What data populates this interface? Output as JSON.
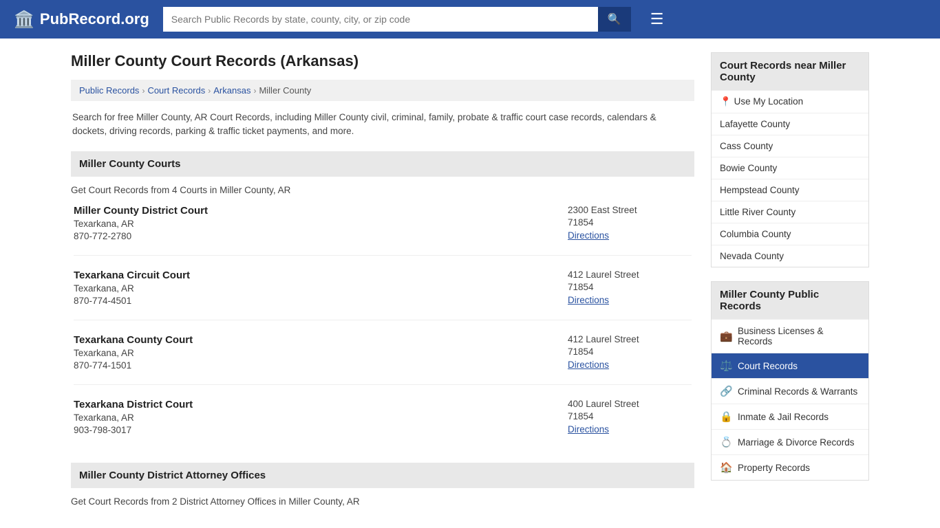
{
  "header": {
    "logo_text": "PubRecord.org",
    "search_placeholder": "Search Public Records by state, county, city, or zip code",
    "search_icon": "🔍",
    "menu_icon": "☰"
  },
  "page": {
    "title": "Miller County Court Records (Arkansas)",
    "breadcrumbs": [
      {
        "label": "Public Records",
        "href": "#"
      },
      {
        "label": "Court Records",
        "href": "#"
      },
      {
        "label": "Arkansas",
        "href": "#"
      },
      {
        "label": "Miller County",
        "href": "#"
      }
    ],
    "description": "Search for free Miller County, AR Court Records, including Miller County civil, criminal, family, probate & traffic court case records, calendars & dockets, driving records, parking & traffic ticket payments, and more."
  },
  "courts_section": {
    "header": "Miller County Courts",
    "intro": "Get Court Records from 4 Courts in Miller County, AR",
    "courts": [
      {
        "name": "Miller County District Court",
        "city": "Texarkana, AR",
        "phone": "870-772-2780",
        "street": "2300 East Street",
        "zip": "71854",
        "directions_label": "Directions"
      },
      {
        "name": "Texarkana Circuit Court",
        "city": "Texarkana, AR",
        "phone": "870-774-4501",
        "street": "412 Laurel Street",
        "zip": "71854",
        "directions_label": "Directions"
      },
      {
        "name": "Texarkana County Court",
        "city": "Texarkana, AR",
        "phone": "870-774-1501",
        "street": "412 Laurel Street",
        "zip": "71854",
        "directions_label": "Directions"
      },
      {
        "name": "Texarkana District Court",
        "city": "Texarkana, AR",
        "phone": "903-798-3017",
        "street": "400 Laurel Street",
        "zip": "71854",
        "directions_label": "Directions"
      }
    ]
  },
  "da_section": {
    "header": "Miller County District Attorney Offices",
    "intro": "Get Court Records from 2 District Attorney Offices in Miller County, AR"
  },
  "sidebar": {
    "nearby_header": "Court Records near Miller County",
    "nearby_items": [
      {
        "label": "Use My Location",
        "icon": "📍",
        "is_location": true
      },
      {
        "label": "Lafayette County"
      },
      {
        "label": "Cass County"
      },
      {
        "label": "Bowie County"
      },
      {
        "label": "Hempstead County"
      },
      {
        "label": "Little River County"
      },
      {
        "label": "Columbia County"
      },
      {
        "label": "Nevada County"
      }
    ],
    "public_records_header": "Miller County Public Records",
    "public_records_items": [
      {
        "label": "Business Licenses & Records",
        "icon": "💼",
        "active": false
      },
      {
        "label": "Court Records",
        "icon": "⚖️",
        "active": true
      },
      {
        "label": "Criminal Records & Warrants",
        "icon": "🔗",
        "active": false
      },
      {
        "label": "Inmate & Jail Records",
        "icon": "🔒",
        "active": false
      },
      {
        "label": "Marriage & Divorce Records",
        "icon": "💍",
        "active": false
      },
      {
        "label": "Property Records",
        "icon": "🏠",
        "active": false
      }
    ]
  }
}
